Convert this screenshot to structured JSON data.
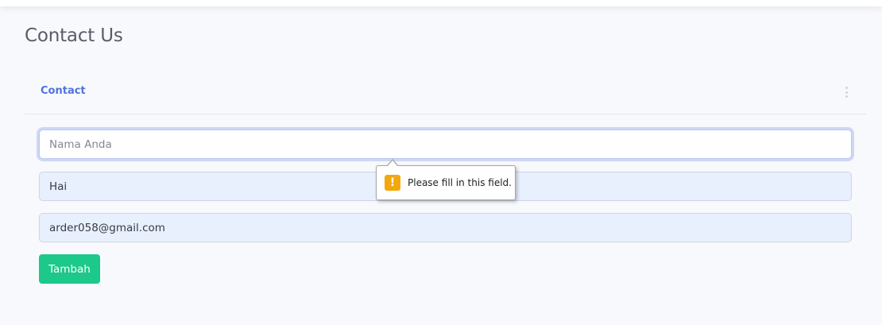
{
  "page": {
    "title": "Contact Us"
  },
  "card": {
    "header_title": "Contact",
    "menu_icon": "kebab-vertical-icon"
  },
  "form": {
    "name": {
      "value": "",
      "placeholder": "Nama Anda"
    },
    "subject": {
      "value": "Hai",
      "placeholder": ""
    },
    "email": {
      "value": "arder058@gmail.com",
      "placeholder": ""
    },
    "submit_label": "Tambah"
  },
  "validation": {
    "icon": "warning-icon",
    "icon_glyph": "!",
    "message": "Please fill in this field."
  },
  "colors": {
    "primary": "#4e73df",
    "success": "#1cc88a",
    "warning": "#f4a70b",
    "page_bg": "#f8f9fc",
    "autofill_bg": "#e8f0fe"
  }
}
